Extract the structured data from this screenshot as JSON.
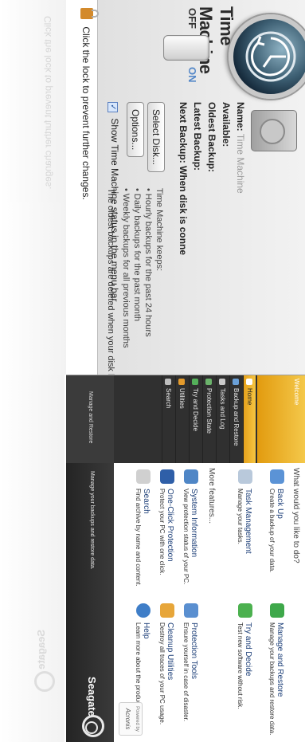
{
  "time_machine": {
    "title": "Time Machine",
    "switch_off": "OFF",
    "switch_on": "ON",
    "name_label": "Name:",
    "name_value": "Time Machine",
    "available_label": "Available:",
    "oldest_label": "Oldest Backup:",
    "latest_label": "Latest Backup:",
    "next_label": "Next Backup: When disk is conne",
    "select_disk_button": "Select Disk...",
    "options_button": "Options...",
    "keeps_heading": "Time Machine keeps:",
    "keeps_items": [
      "• Hourly backups for the past 24 hours",
      "• Daily backups for the past month",
      "• Weekly backups for all previous months"
    ],
    "keeps_note": "The oldest backups are deleted when your disk becomes fu",
    "menu_bar_checkbox": "Show Time Machine status in the menu bar",
    "lock_text": "Click the lock to prevent further changes."
  },
  "seagate": {
    "welcome": "Welcome",
    "sidebar_items": [
      "Home",
      "Backup and Restore",
      "Tasks and Log",
      "Protection State",
      "Try and Decide",
      "Utilities",
      "Search"
    ],
    "sidebar_bottom": "Manage and Restore",
    "question": "What would you like to do?",
    "more_features": "More features...",
    "features_top": [
      {
        "title": "Back Up",
        "sub": "Create a backup of your data."
      },
      {
        "title": "Manage and Restore",
        "sub": "Manage your backups and restore data."
      },
      {
        "title": "Task Management",
        "sub": "Manage your tasks."
      },
      {
        "title": "Try and Decide",
        "sub": "Test new software without risk."
      }
    ],
    "features_more": [
      {
        "title": "System Information",
        "sub": "View protection status of your PC."
      },
      {
        "title": "Protection Tools",
        "sub": "Ensure yourself in case of disaster."
      },
      {
        "title": "One-Click Protection",
        "sub": "Protect your PC with one click."
      },
      {
        "title": "Cleanup Utilities",
        "sub": "Destroy all traces of your PC usage."
      },
      {
        "title": "Search",
        "sub": "Find archive by name and content."
      },
      {
        "title": "Help",
        "sub": "Learn more about the product."
      }
    ],
    "footer_message": "Manage your backups and restore data.",
    "brand": "Seagate",
    "powered_by": "Powered by",
    "acronis": "Acronis"
  }
}
